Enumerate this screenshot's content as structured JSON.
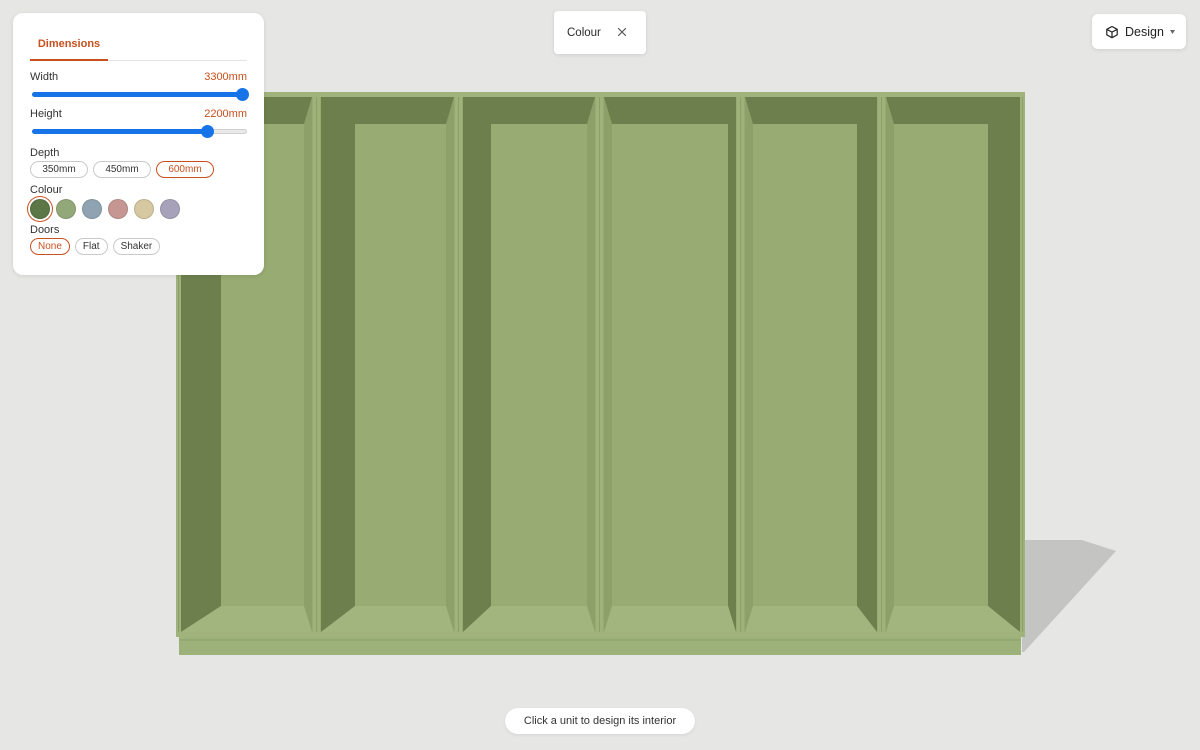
{
  "panel": {
    "tab_label": "Dimensions",
    "width": {
      "label": "Width",
      "value_text": "3300mm",
      "level": 1.0
    },
    "height": {
      "label": "Height",
      "value_text": "2200mm",
      "level": 0.815
    },
    "depth": {
      "label": "Depth",
      "options": [
        "350mm",
        "450mm",
        "600mm"
      ],
      "selected": "600mm"
    },
    "colour": {
      "label": "Colour",
      "swatches": [
        "#5a7745",
        "#93a878",
        "#8fa3b2",
        "#c69792",
        "#d6c8a0",
        "#a7a2ba"
      ],
      "selected_index": 0
    },
    "doors": {
      "label": "Doors",
      "options": [
        "None",
        "Flat",
        "Shaker"
      ],
      "selected": "None"
    }
  },
  "colour_chip": {
    "label": "Colour",
    "close_icon": "close-icon"
  },
  "design_button": {
    "label": "Design",
    "icon": "cube-icon",
    "caret_icon": "caret-down-icon"
  },
  "hint": {
    "text": "Click a unit to design its interior"
  },
  "colors": {
    "accent": "#c8501e",
    "slider": "#1673e8",
    "cabinet_panel": "#97aa72",
    "cabinet_shadow": "#6e7f4e"
  }
}
